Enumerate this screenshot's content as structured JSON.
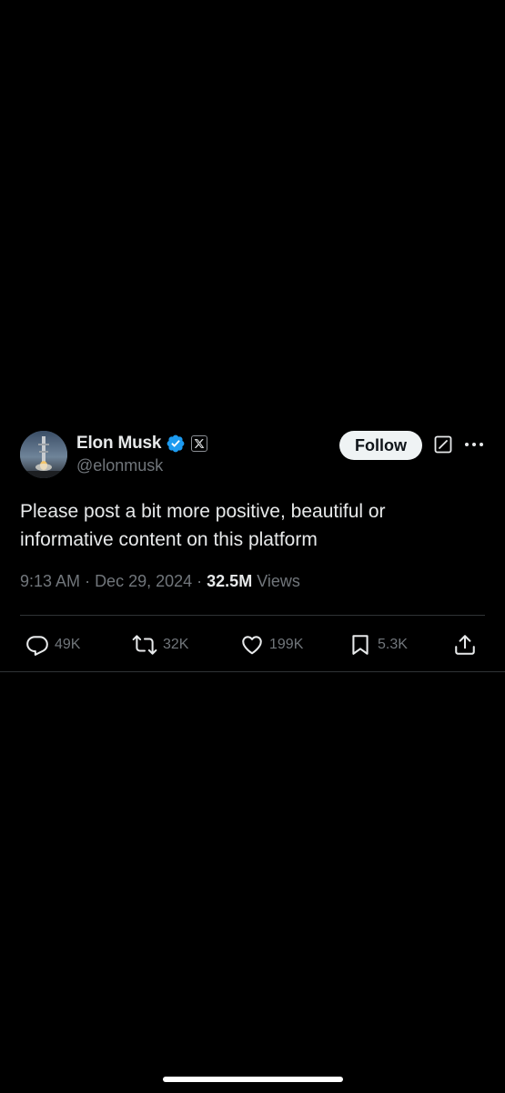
{
  "author": {
    "display_name": "Elon Musk",
    "handle": "@elonmusk",
    "verified_color": "#1d9bf0",
    "affiliation_badge": "x-logo-icon"
  },
  "follow_label": "Follow",
  "post": {
    "text": "Please post a bit more positive, beautiful or informative content on this platform",
    "time": "9:13 AM",
    "date": "Dec 29, 2024",
    "separator": "·",
    "views_count": "32.5M",
    "views_label": "Views"
  },
  "actions": {
    "replies": "49K",
    "reposts": "32K",
    "likes": "199K",
    "bookmarks": "5.3K"
  },
  "colors": {
    "background": "#000000",
    "text_primary": "#e7e9ea",
    "text_secondary": "#71767b",
    "divider": "#2f3336",
    "accent": "#1d9bf0"
  }
}
